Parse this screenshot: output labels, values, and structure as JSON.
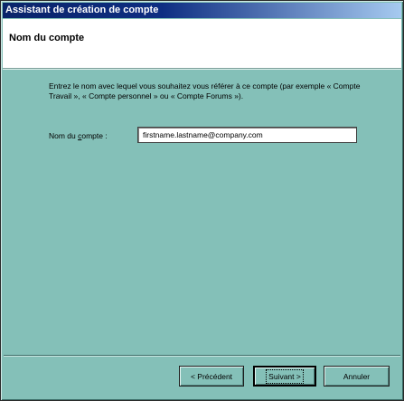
{
  "window": {
    "title": "Assistant de création de compte"
  },
  "header": {
    "title": "Nom du compte"
  },
  "body": {
    "description": "Entrez le nom avec lequel vous souhaitez vous référer à ce compte (par exemple « Compte Travail », « Compte personnel » ou « Compte Forums »).",
    "field_label_prefix": "Nom du ",
    "field_label_accel": "c",
    "field_label_suffix": "ompte :",
    "account_name_value": "firstname.lastname@company.com"
  },
  "buttons": {
    "previous": "< Précédent",
    "next": "Suivant >",
    "cancel": "Annuler"
  },
  "colors": {
    "dialog_bg": "#84c0b8",
    "titlebar_start": "#0a246a",
    "titlebar_end": "#a6caf0"
  }
}
